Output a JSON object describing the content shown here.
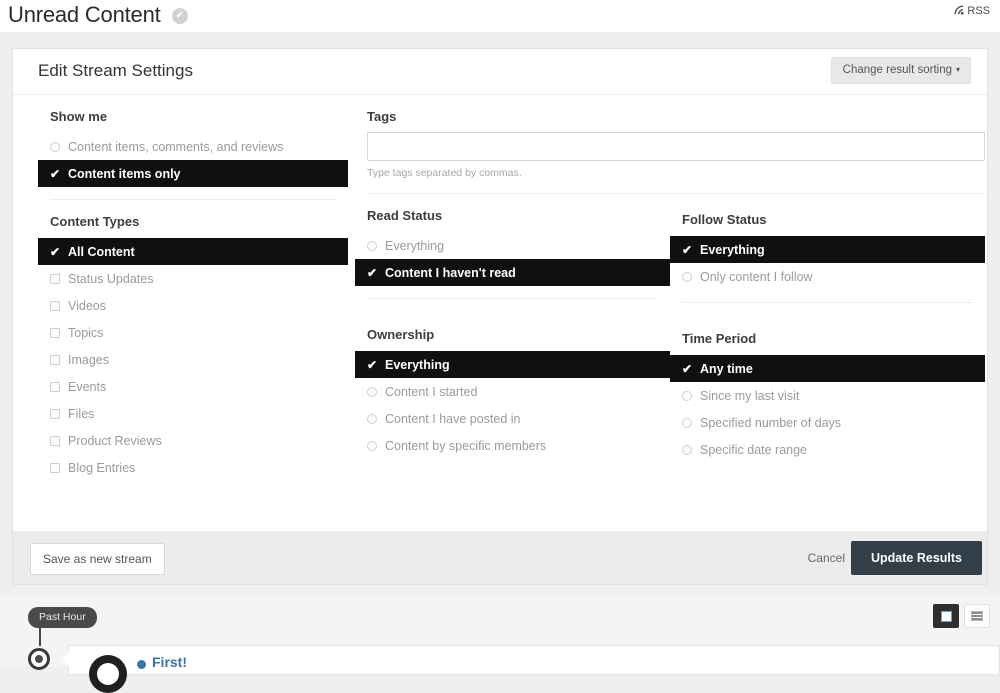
{
  "header": {
    "title": "Unread Content",
    "verified_icon": "✔",
    "rss_label": "RSS",
    "rss_glyph": "📶"
  },
  "card": {
    "title": "Edit Stream Settings",
    "sort_button": "Change result sorting",
    "caret": "▾"
  },
  "show_me": {
    "title": "Show me",
    "options": [
      {
        "label": "Content items, comments, and reviews",
        "selected": false
      },
      {
        "label": "Content items only",
        "selected": true
      }
    ]
  },
  "content_types": {
    "title": "Content Types",
    "options": [
      {
        "label": "All Content",
        "selected": true
      },
      {
        "label": "Status Updates",
        "selected": false
      },
      {
        "label": "Videos",
        "selected": false
      },
      {
        "label": "Topics",
        "selected": false
      },
      {
        "label": "Images",
        "selected": false
      },
      {
        "label": "Events",
        "selected": false
      },
      {
        "label": "Files",
        "selected": false
      },
      {
        "label": "Product Reviews",
        "selected": false
      },
      {
        "label": "Blog Entries",
        "selected": false
      }
    ]
  },
  "tags": {
    "title": "Tags",
    "value": "",
    "placeholder": "",
    "help": "Type tags separated by commas."
  },
  "read_status": {
    "title": "Read Status",
    "options": [
      {
        "label": "Everything",
        "selected": false
      },
      {
        "label": "Content I haven't read",
        "selected": true
      }
    ]
  },
  "follow_status": {
    "title": "Follow Status",
    "options": [
      {
        "label": "Everything",
        "selected": true
      },
      {
        "label": "Only content I follow",
        "selected": false
      }
    ]
  },
  "ownership": {
    "title": "Ownership",
    "options": [
      {
        "label": "Everything",
        "selected": true
      },
      {
        "label": "Content I started",
        "selected": false
      },
      {
        "label": "Content I have posted in",
        "selected": false
      },
      {
        "label": "Content by specific members",
        "selected": false
      }
    ]
  },
  "time_period": {
    "title": "Time Period",
    "options": [
      {
        "label": "Any time",
        "selected": true
      },
      {
        "label": "Since my last visit",
        "selected": false
      },
      {
        "label": "Specified number of days",
        "selected": false
      },
      {
        "label": "Specific date range",
        "selected": false
      }
    ]
  },
  "footer": {
    "save_label": "Save as new stream",
    "cancel_label": "Cancel",
    "update_label": "Update Results"
  },
  "timeline": {
    "badge": "Past Hour",
    "view_grid_icon": "grid-view-icon",
    "view_list_icon": "list-view-icon"
  },
  "teaser": {
    "title": "First!"
  },
  "colors": {
    "selected_bg": "#101010",
    "accent_link": "#3a72ab",
    "primary_button": "#323e48",
    "page_bg": "#efefef"
  }
}
